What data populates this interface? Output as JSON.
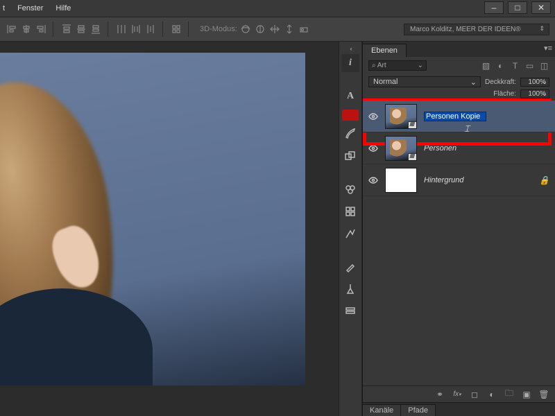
{
  "menu": {
    "fenster": "Fenster",
    "hilfe": "Hilfe"
  },
  "options_bar": {
    "mode3d_label": "3D-Modus:",
    "user_label": "Marco Kolditz, MEER DER IDEEN®"
  },
  "panels": {
    "layers": {
      "tab": "Ebenen",
      "search_label": "Art",
      "blend_mode": "Normal",
      "opacity_label": "Deckkraft:",
      "opacity_value": "100%",
      "fill_label": "Fläche:",
      "fill_value": "100%"
    },
    "channels_tab": "Kanäle",
    "paths_tab": "Pfade"
  },
  "layers_list": [
    {
      "name_editing": "Personen Kopie",
      "selected": true,
      "smart": true
    },
    {
      "name": "Personen",
      "smart": true
    },
    {
      "name": "Hintergrund",
      "locked": true
    }
  ],
  "icons": {
    "search_prefix": "⌕"
  }
}
